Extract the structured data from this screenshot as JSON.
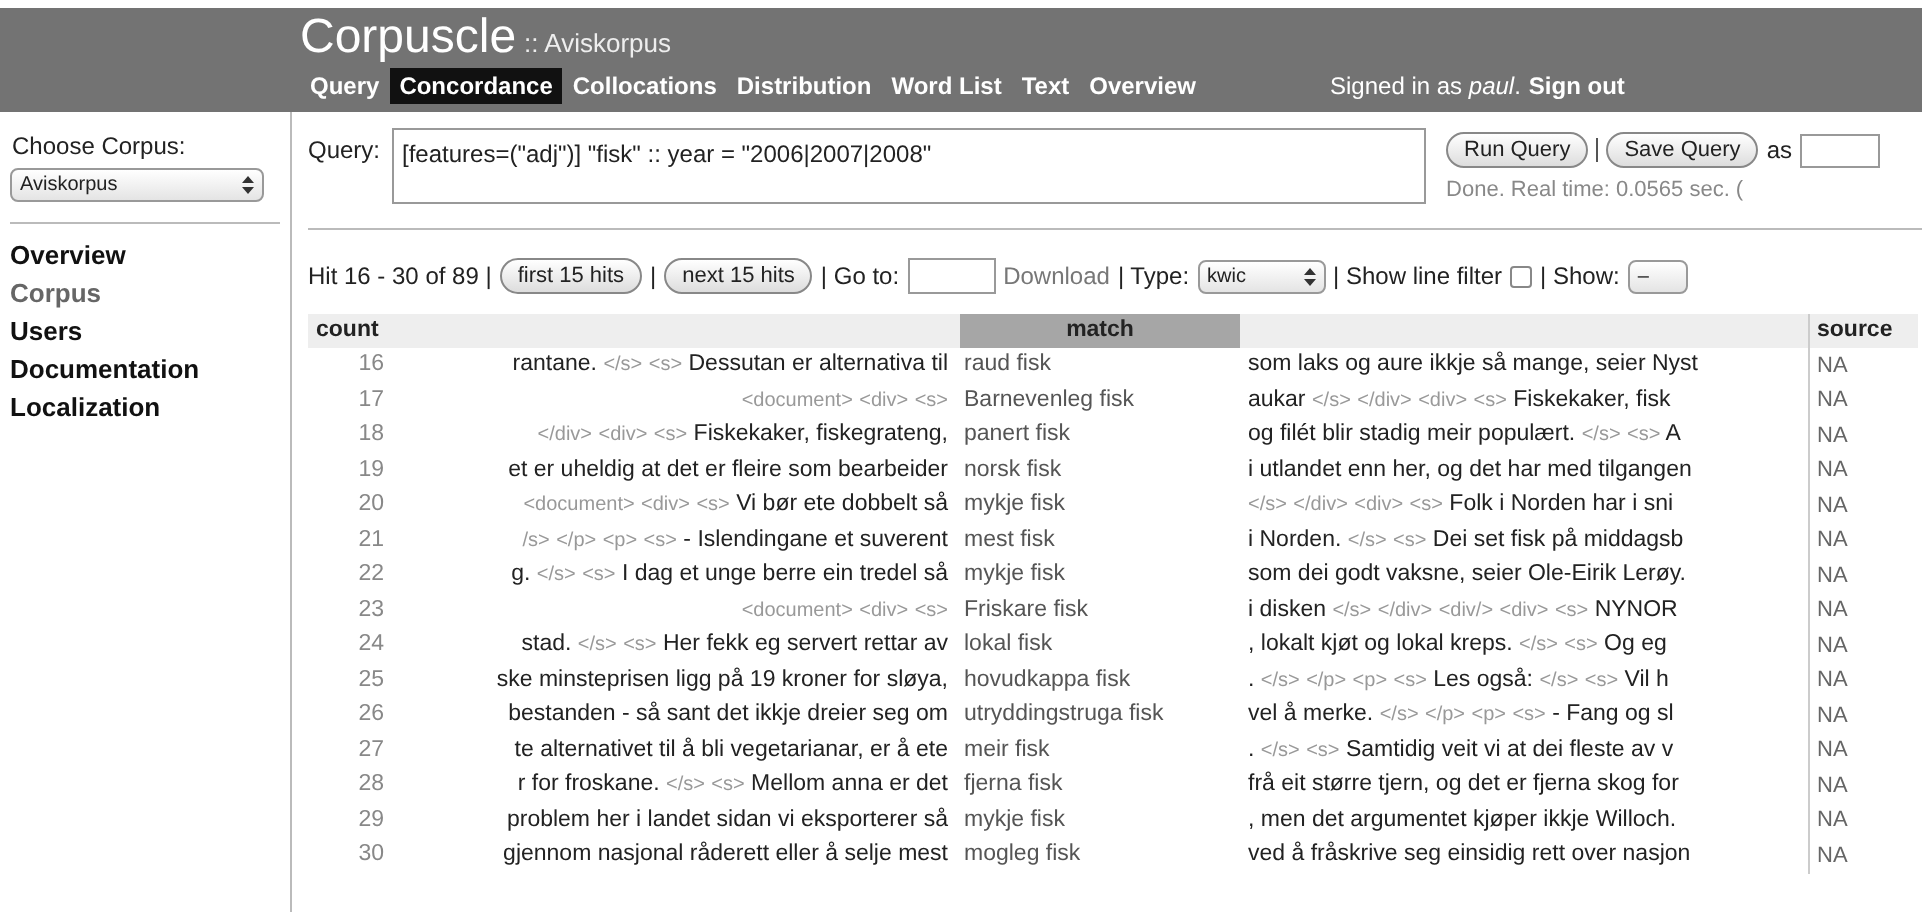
{
  "header": {
    "title": "Corpuscle",
    "subtitle": ":: Aviskorpus",
    "tabs": [
      {
        "label": "Query",
        "selected": false
      },
      {
        "label": "Concordance",
        "selected": true
      },
      {
        "label": "Collocations",
        "selected": false
      },
      {
        "label": "Distribution",
        "selected": false
      },
      {
        "label": "Word List",
        "selected": false
      },
      {
        "label": "Text",
        "selected": false
      },
      {
        "label": "Overview",
        "selected": false
      }
    ],
    "signed_in": "Signed in as *paul*.",
    "sign_out": "Sign out"
  },
  "sidebar": {
    "label": "Choose Corpus:",
    "corpus": "Aviskorpus",
    "items": [
      {
        "label": "Overview",
        "selected": false
      },
      {
        "label": "Corpus",
        "selected": true
      },
      {
        "label": "Users",
        "selected": false
      },
      {
        "label": "Documentation",
        "selected": false
      },
      {
        "label": "Localization",
        "selected": false
      }
    ]
  },
  "query": {
    "label": "Query:",
    "value": "[features=(\"adj\")] \"fisk\" :: year = \"2006|2007|2008\"",
    "run": "Run Query",
    "save": "Save Query",
    "as": "as",
    "status": "Done. Real time: 0.0565 sec. ("
  },
  "hits": {
    "summary": "Hit 16 - 30 of 89 |",
    "first": "first 15 hits",
    "sep": "|",
    "next": "next 15 hits",
    "goto": "| Go to:",
    "download": "Download",
    "type_label": "| Type:",
    "type": "kwic",
    "filter_label": "| Show line filter",
    "filter_checked": false,
    "show_label": "| Show:",
    "show": "–"
  },
  "table": {
    "columns": [
      "count",
      "",
      "match",
      "",
      "source"
    ],
    "rows": [
      {
        "count": "16",
        "left": "rantane. </s> <s> Dessutan er alternativa til",
        "match": "raud fisk",
        "right": "som laks og aure ikkje så mange, seier Nyst",
        "source": "NA"
      },
      {
        "count": "17",
        "left": "<document> <div> <s>",
        "match": "Barnevenleg fisk",
        "right": "aukar </s> </div> <div> <s> Fiskekaker, fisk",
        "source": "NA"
      },
      {
        "count": "18",
        "left": "</div> <div> <s> Fiskekaker, fiskegrateng,",
        "match": "panert fisk",
        "right": "og filét blir stadig meir populært. </s> <s> A",
        "source": "NA"
      },
      {
        "count": "19",
        "left": "et er uheldig at det er fleire som bearbeider",
        "match": "norsk fisk",
        "right": "i utlandet enn her, og det har med tilgangen",
        "source": "NA"
      },
      {
        "count": "20",
        "left": "<document> <div> <s> Vi bør ete dobbelt så",
        "match": "mykje fisk",
        "right": "</s> </div> <div> <s> Folk i Norden har i sni",
        "source": "NA"
      },
      {
        "count": "21",
        "left": "/s> </p> <p> <s> - Islendingane et suverent",
        "match": "mest fisk",
        "right": "i Norden. </s> <s> Dei set fisk på middagsb",
        "source": "NA"
      },
      {
        "count": "22",
        "left": "g. </s> <s> I dag et unge berre ein tredel så",
        "match": "mykje fisk",
        "right": "som dei godt vaksne, seier Ole-Eirik Lerøy.",
        "source": "NA"
      },
      {
        "count": "23",
        "left": "<document> <div> <s>",
        "match": "Friskare fisk",
        "right": "i disken </s> </div> <div/> <div> <s> NYNOR",
        "source": "NA"
      },
      {
        "count": "24",
        "left": "stad. </s> <s> Her fekk eg servert rettar av",
        "match": "lokal fisk",
        "right": ", lokalt kjøt og lokal kreps. </s> <s> Og eg",
        "source": "NA"
      },
      {
        "count": "25",
        "left": "ske minsteprisen ligg på 19 kroner for sløya,",
        "match": "hovudkappa fisk",
        "right": ". </s> </p> <p> <s> Les også: </s> <s> Vil h",
        "source": "NA"
      },
      {
        "count": "26",
        "left": "bestanden - så sant det ikkje dreier seg om",
        "match": "utryddingstruga fisk",
        "right": "vel å merke. </s> </p> <p> <s> - Fang og sl",
        "source": "NA"
      },
      {
        "count": "27",
        "left": "te alternativet til å bli vegetarianar, er å ete",
        "match": "meir fisk",
        "right": ". </s> <s> Samtidig veit vi at dei fleste av v",
        "source": "NA"
      },
      {
        "count": "28",
        "left": "r for froskane. </s> <s> Mellom anna er det",
        "match": "fjerna fisk",
        "right": "frå eit større tjern, og det er fjerna skog for",
        "source": "NA"
      },
      {
        "count": "29",
        "left": "problem her i landet sidan vi eksporterer så",
        "match": "mykje fisk",
        "right": ", men det argumentet kjøper ikkje Willoch.",
        "source": "NA"
      },
      {
        "count": "30",
        "left": "gjennom nasjonal råderett eller å selje mest",
        "match": "mogleg fisk",
        "right": "ved å fråskrive seg einsidig rett over nasjon",
        "source": "NA"
      }
    ]
  }
}
